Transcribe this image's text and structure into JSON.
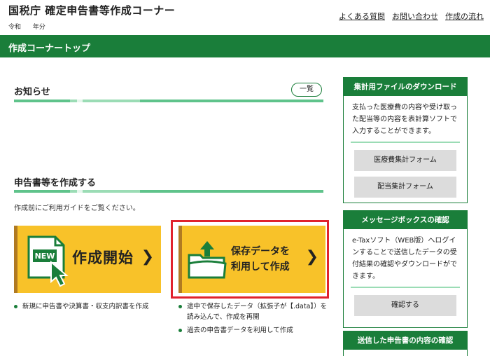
{
  "header": {
    "site_title": "国税庁 確定申告書等作成コーナー",
    "era_label": "令和",
    "year_label": "年分",
    "links": [
      "よくある質問",
      "お問い合わせ",
      "作成の流れ"
    ]
  },
  "navbar": {
    "title": "作成コーナートップ"
  },
  "notice": {
    "heading": "お知らせ",
    "list_button": "一覧"
  },
  "create": {
    "heading": "申告書等を作成する",
    "guide": "作成前にご利用ガイドをご覧ください。",
    "start_card": {
      "badge": "NEW",
      "label": "作成開始"
    },
    "saved_card": {
      "line1": "保存データを",
      "line2": "利用して作成"
    },
    "start_bullets": [
      "新規に申告書や決算書・収支内訳書を作成"
    ],
    "saved_bullets": [
      "途中で保存したデータ（拡張子が【.data】）を読み込んで、作成を再開",
      "過去の申告書データを利用して作成"
    ]
  },
  "sidebar": {
    "download": {
      "heading": "集計用ファイルのダウンロード",
      "text": "支払った医療費の内容や受け取った配当等の内容を表計算ソフトで入力することができます。",
      "button1": "医療費集計フォーム",
      "button2": "配当集計フォーム"
    },
    "messagebox": {
      "heading": "メッセージボックスの確認",
      "text": "e-Taxソフト（WEB版）へログインすることで送信したデータの受付結果の確認やダウンロードができます。",
      "button": "確認する"
    },
    "sent": {
      "heading": "送信した申告書の内容の確認"
    }
  },
  "colors": {
    "brand_green": "#1a7e3a",
    "card_yellow": "#f8c229",
    "highlight_red": "#e0222d"
  },
  "icons": [
    "new-document-icon",
    "pointer-arrow-icon",
    "folder-upload-icon",
    "chevron-right-icon"
  ]
}
